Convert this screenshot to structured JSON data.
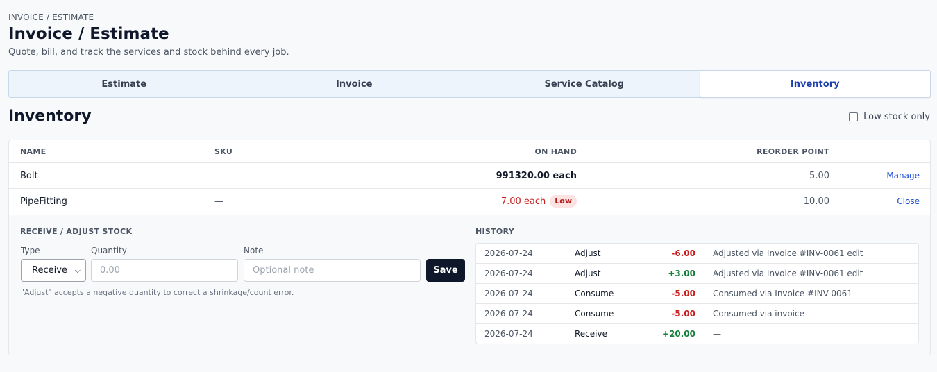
{
  "breadcrumb": "INVOICE / ESTIMATE",
  "page_title": "Invoice / Estimate",
  "subtitle": "Quote, bill, and track the services and stock behind every job.",
  "tabs": [
    {
      "label": "Estimate",
      "active": false
    },
    {
      "label": "Invoice",
      "active": false
    },
    {
      "label": "Service Catalog",
      "active": false
    },
    {
      "label": "Inventory",
      "active": true
    }
  ],
  "section_title": "Inventory",
  "low_stock_filter": {
    "label": "Low stock only",
    "checked": false
  },
  "table": {
    "headers": {
      "name": "NAME",
      "sku": "SKU",
      "on_hand": "ON HAND",
      "reorder_point": "REORDER POINT"
    },
    "rows": [
      {
        "name": "Bolt",
        "sku": "—",
        "on_hand": "991320.00 each",
        "low": false,
        "reorder_point": "5.00",
        "action": "Manage"
      },
      {
        "name": "PipeFitting",
        "sku": "—",
        "on_hand": "7.00 each",
        "low": true,
        "low_badge": "Low",
        "reorder_point": "10.00",
        "action": "Close"
      }
    ]
  },
  "adjust": {
    "heading": "RECEIVE / ADJUST STOCK",
    "type_label": "Type",
    "type_value": "Receive",
    "quantity_label": "Quantity",
    "quantity_placeholder": "0.00",
    "note_label": "Note",
    "note_placeholder": "Optional note",
    "save_label": "Save",
    "hint": "\"Adjust\" accepts a negative quantity to correct a shrinkage/count error."
  },
  "history": {
    "heading": "HISTORY",
    "rows": [
      {
        "date": "2026-07-24",
        "type": "Adjust",
        "qty": "-6.00",
        "sign": "neg",
        "note": "Adjusted via Invoice #INV-0061 edit"
      },
      {
        "date": "2026-07-24",
        "type": "Adjust",
        "qty": "+3.00",
        "sign": "pos",
        "note": "Adjusted via Invoice #INV-0061 edit"
      },
      {
        "date": "2026-07-24",
        "type": "Consume",
        "qty": "-5.00",
        "sign": "neg",
        "note": "Consumed via Invoice #INV-0061"
      },
      {
        "date": "2026-07-24",
        "type": "Consume",
        "qty": "-5.00",
        "sign": "neg",
        "note": "Consumed via invoice"
      },
      {
        "date": "2026-07-24",
        "type": "Receive",
        "qty": "+20.00",
        "sign": "pos",
        "note": "—"
      }
    ]
  },
  "colors": {
    "accent": "#1e40af",
    "negative": "#c81e1e",
    "positive": "#15803d",
    "button": "#0f172a"
  }
}
